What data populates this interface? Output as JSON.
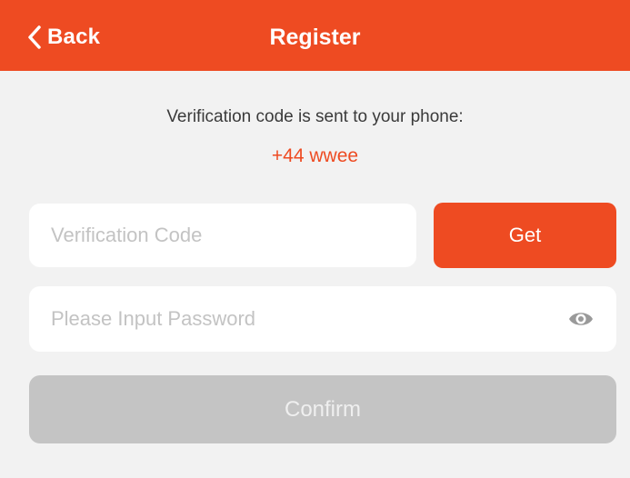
{
  "header": {
    "back_label": "Back",
    "title": "Register",
    "icons": {
      "back": "chevron-left-icon"
    }
  },
  "info": {
    "message": "Verification code is sent to your phone:",
    "phone": "+44 wwee"
  },
  "form": {
    "code_placeholder": "Verification Code",
    "code_value": "",
    "get_label": "Get",
    "password_placeholder": "Please Input Password",
    "password_value": "",
    "password_toggle_icon": "eye-icon",
    "confirm_label": "Confirm"
  },
  "colors": {
    "accent": "#ee4b22",
    "background": "#f2f2f2",
    "disabled_button": "#c4c4c4",
    "field": "#ffffff"
  }
}
